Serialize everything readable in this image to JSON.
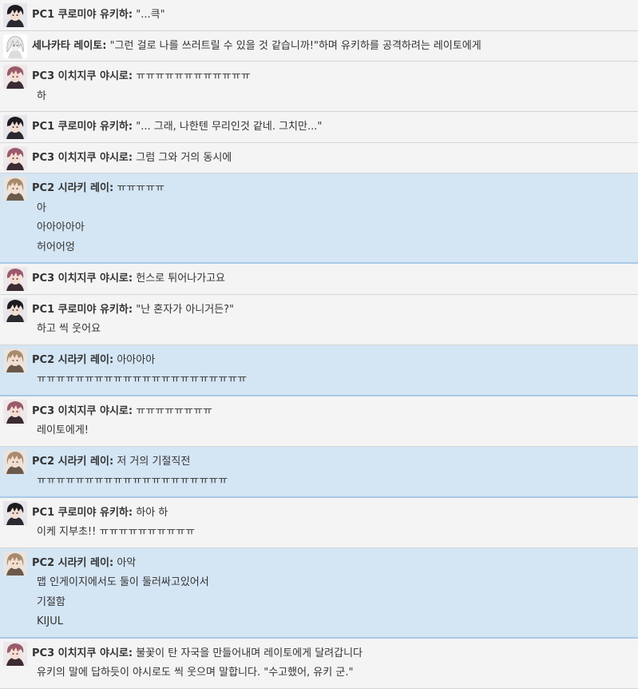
{
  "colors": {
    "row_default": "#f4f4f4",
    "row_pc2": "#d4e5f4",
    "divider": "#d5d5d5"
  },
  "messages": [
    {
      "speaker": "PC1 쿠로미야 유키하:",
      "avatar": "pc1-avatar-icon",
      "lines": [
        "\"...큭\""
      ]
    },
    {
      "speaker": "세나카타 레이토:",
      "avatar": "reito-avatar-icon",
      "lines": [
        "\"그런 걸로 나를 쓰러트릴 수 있을 것 같습니까!\"하며 유키하를 공격하려는 레이토에게"
      ]
    },
    {
      "speaker": "PC3 이치지쿠 야시로:",
      "avatar": "pc3-avatar-icon",
      "lines": [
        "ㅠㅠㅠㅠㅠㅠㅠㅠㅠㅠㅠㅠ",
        "하"
      ]
    },
    {
      "speaker": "PC1 쿠로미야 유키하:",
      "avatar": "pc1-avatar-icon",
      "lines": [
        "\"... 그래, 나한텐 무리인것 같네. 그치만...\""
      ]
    },
    {
      "speaker": "PC3 이치지쿠 야시로:",
      "avatar": "pc3-avatar-icon",
      "lines": [
        "그럼 그와 거의 동시에"
      ]
    },
    {
      "speaker": "PC2 시라키 레이:",
      "avatar": "pc2-avatar-icon",
      "lines": [
        "ㅠㅠㅠㅠㅠ",
        "아",
        "아아아아아",
        "허어어엉"
      ]
    },
    {
      "speaker": "PC3 이치지쿠 야시로:",
      "avatar": "pc3-avatar-icon",
      "lines": [
        "헌스로 튀어나가고요"
      ]
    },
    {
      "speaker": "PC1 쿠로미야 유키하:",
      "avatar": "pc1-avatar-icon",
      "lines": [
        "\"난 혼자가 아니거든?\"",
        "하고 씩 웃어요"
      ]
    },
    {
      "speaker": "PC2 시라키 레이:",
      "avatar": "pc2-avatar-icon",
      "lines": [
        "아아아아",
        "ㅠㅠㅠㅠㅠㅠㅠㅠㅠㅠㅠㅠㅠㅠㅠㅠㅠㅠㅠㅠㅠㅠ"
      ]
    },
    {
      "speaker": "PC3 이치지쿠 야시로:",
      "avatar": "pc3-avatar-icon",
      "lines": [
        "ㅠㅠㅠㅠㅠㅠㅠㅠ",
        "레이토에게!"
      ]
    },
    {
      "speaker": "PC2 시라키 레이:",
      "avatar": "pc2-avatar-icon",
      "lines": [
        "저 거의 기절직전",
        "ㅠㅠㅠㅠㅠㅠㅠㅠㅠㅠㅠㅠㅠㅠㅠㅠㅠㅠㅠㅠ"
      ]
    },
    {
      "speaker": "PC1 쿠로미야 유키하:",
      "avatar": "pc1-avatar-icon",
      "lines": [
        "하아 하",
        "이케 지부초!! ㅠㅠㅠㅠㅠㅠㅠㅠㅠㅠ"
      ]
    },
    {
      "speaker": "PC2 시라키 레이:",
      "avatar": "pc2-avatar-icon",
      "lines": [
        "아악",
        "맵 인게이지에서도 둘이 둘러싸고있어서",
        "기절함",
        "KIJUL"
      ]
    },
    {
      "speaker": "PC3 이치지쿠 야시로:",
      "avatar": "pc3-avatar-icon",
      "lines": [
        "불꽃이 탄 자국을 만들어내며 레이토에게 달려갑니다",
        "유키의 말에 답하듯이 야시로도 씩 웃으며 말합니다. \"수고했어, 유키 군.\""
      ]
    }
  ]
}
